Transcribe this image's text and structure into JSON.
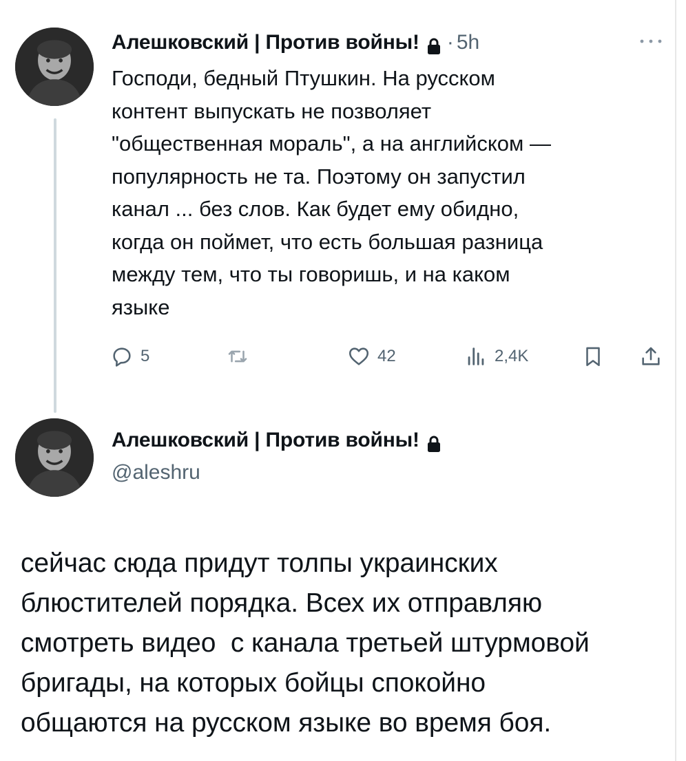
{
  "tweet1": {
    "author_name": "Алешковский | Против войны!",
    "separator": "·",
    "time": "5h",
    "text": "Господи, бедный Птушкин. На русском\nконтент выпускать не позволяет\n\"общественная мораль\", а на английском —\nпопулярность не та. Поэтому он запустил\nканал ... без слов. Как будет ему обидно,\nкогда он поймет, что есть большая разница\nмежду тем, что ты говоришь, и на каком\nязыке",
    "actions": {
      "replies": "5",
      "retweets": "",
      "likes": "42",
      "views": "2,4K"
    }
  },
  "tweet2": {
    "author_name": "Алешковский | Против войны!",
    "handle": "@aleshru",
    "text": "сейчас сюда придут толпы украинских\nблюстителей порядка. Всех их отправляю\nсмотреть видео  с канала третьей штурмовой\nбригады, на которых бойцы спокойно\nобщаются на русском языке во время боя."
  },
  "icons": {
    "lock": "lock-icon",
    "more": "more-icon",
    "reply": "reply-icon",
    "retweet": "retweet-icon",
    "like": "heart-icon",
    "views": "views-icon",
    "bookmark": "bookmark-icon",
    "share": "share-icon"
  },
  "colors": {
    "text": "#0f1419",
    "secondary": "#536471",
    "thread_line": "#cfd9de"
  }
}
